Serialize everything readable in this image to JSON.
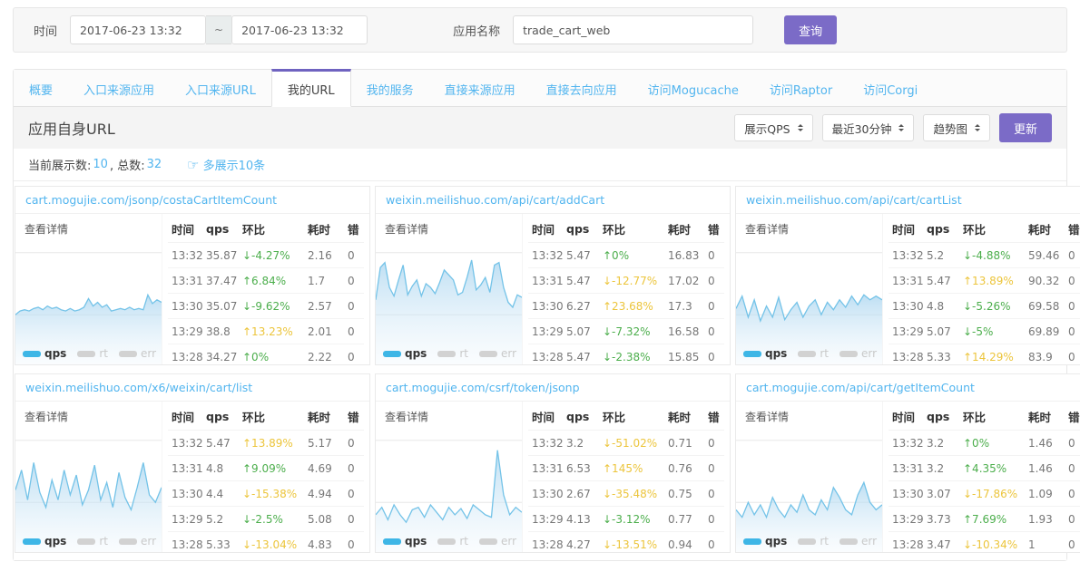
{
  "filter_bar": {
    "time_label": "时间",
    "time_from": "2017-06-23 13:32",
    "time_separator": "~",
    "time_to": "2017-06-23 13:32",
    "app_label": "应用名称",
    "app_value": "trade_cart_web",
    "query_button": "查询"
  },
  "tabs": {
    "items": [
      {
        "label": "概要",
        "active": false
      },
      {
        "label": "入口来源应用",
        "active": false
      },
      {
        "label": "入口来源URL",
        "active": false
      },
      {
        "label": "我的URL",
        "active": true
      },
      {
        "label": "我的服务",
        "active": false
      },
      {
        "label": "直接来源应用",
        "active": false
      },
      {
        "label": "直接去向应用",
        "active": false
      },
      {
        "label": "访问Mogucache",
        "active": false
      },
      {
        "label": "访问Raptor",
        "active": false
      },
      {
        "label": "访问Corgi",
        "active": false
      }
    ]
  },
  "section": {
    "title": "应用自身URL",
    "metric_select": "展示QPS",
    "range_select": "最近30分钟",
    "chart_type_select": "趋势图",
    "refresh_button": "更新"
  },
  "summary": {
    "shown_label": "当前展示数:",
    "shown_value": "10",
    "total_label": ", 总数:",
    "total_value": "32",
    "more_icon": "☞",
    "more_link": "多展示10条"
  },
  "panel_common": {
    "detail_label": "查看详情",
    "columns": [
      "时间",
      "qps",
      "环比",
      "耗时",
      "错"
    ],
    "legend": [
      {
        "label": "qps",
        "active": true
      },
      {
        "label": "rt",
        "active": false
      },
      {
        "label": "err",
        "active": false
      }
    ]
  },
  "colors": {
    "accent_purple": "#7b6bc7",
    "link_blue": "#52b5ef",
    "delta_green": "#4cae4c",
    "delta_yellow": "#ecc53c",
    "spark_line": "#74c3e8"
  },
  "panels": [
    {
      "url": "cart.mogujie.com/jsonp/costaCartItemCount",
      "rows": [
        {
          "time": "13:32",
          "qps": "35.87",
          "dir": "down",
          "delta": "-4.27%",
          "tone": "green",
          "cost": "2.16",
          "err": "0"
        },
        {
          "time": "13:31",
          "qps": "37.47",
          "dir": "up",
          "delta": "6.84%",
          "tone": "green",
          "cost": "1.7",
          "err": "0"
        },
        {
          "time": "13:30",
          "qps": "35.07",
          "dir": "down",
          "delta": "-9.62%",
          "tone": "green",
          "cost": "2.57",
          "err": "0"
        },
        {
          "time": "13:29",
          "qps": "38.8",
          "dir": "up",
          "delta": "13.23%",
          "tone": "yellow",
          "cost": "2.01",
          "err": "0"
        },
        {
          "time": "13:28",
          "qps": "34.27",
          "dir": "up",
          "delta": "0%",
          "tone": "green",
          "cost": "2.22",
          "err": "0"
        }
      ],
      "spark": [
        0.4,
        0.43,
        0.44,
        0.43,
        0.45,
        0.46,
        0.44,
        0.47,
        0.45,
        0.46,
        0.44,
        0.43,
        0.45,
        0.43,
        0.44,
        0.46,
        0.53,
        0.47,
        0.5,
        0.46,
        0.48,
        0.43,
        0.44,
        0.45,
        0.44,
        0.46,
        0.44,
        0.45,
        0.44,
        0.56,
        0.49,
        0.52,
        0.5
      ]
    },
    {
      "url": "weixin.meilishuo.com/api/cart/addCart",
      "rows": [
        {
          "time": "13:32",
          "qps": "5.47",
          "dir": "up",
          "delta": "0%",
          "tone": "green",
          "cost": "16.83",
          "err": "0"
        },
        {
          "time": "13:31",
          "qps": "5.47",
          "dir": "down",
          "delta": "-12.77%",
          "tone": "yellow",
          "cost": "17.02",
          "err": "0"
        },
        {
          "time": "13:30",
          "qps": "6.27",
          "dir": "up",
          "delta": "23.68%",
          "tone": "yellow",
          "cost": "17.3",
          "err": "0"
        },
        {
          "time": "13:29",
          "qps": "5.07",
          "dir": "down",
          "delta": "-7.32%",
          "tone": "green",
          "cost": "16.58",
          "err": "0"
        },
        {
          "time": "13:28",
          "qps": "5.47",
          "dir": "down",
          "delta": "-2.38%",
          "tone": "green",
          "cost": "15.85",
          "err": "0"
        }
      ],
      "spark": [
        0.52,
        0.78,
        0.82,
        0.62,
        0.55,
        0.68,
        0.8,
        0.56,
        0.63,
        0.68,
        0.55,
        0.65,
        0.62,
        0.57,
        0.66,
        0.76,
        0.72,
        0.68,
        0.56,
        0.58,
        0.7,
        0.84,
        0.6,
        0.64,
        0.7,
        0.58,
        0.8,
        0.82,
        0.62,
        0.5,
        0.46,
        0.56,
        0.54
      ]
    },
    {
      "url": "weixin.meilishuo.com/api/cart/cartList",
      "rows": [
        {
          "time": "13:32",
          "qps": "5.2",
          "dir": "down",
          "delta": "-4.88%",
          "tone": "green",
          "cost": "59.46",
          "err": "0"
        },
        {
          "time": "13:31",
          "qps": "5.47",
          "dir": "up",
          "delta": "13.89%",
          "tone": "yellow",
          "cost": "90.32",
          "err": "0"
        },
        {
          "time": "13:30",
          "qps": "4.8",
          "dir": "down",
          "delta": "-5.26%",
          "tone": "green",
          "cost": "69.58",
          "err": "0"
        },
        {
          "time": "13:29",
          "qps": "5.07",
          "dir": "down",
          "delta": "-5%",
          "tone": "green",
          "cost": "69.89",
          "err": "0"
        },
        {
          "time": "13:28",
          "qps": "5.33",
          "dir": "up",
          "delta": "14.29%",
          "tone": "yellow",
          "cost": "83.9",
          "err": "0"
        }
      ],
      "spark": [
        0.45,
        0.55,
        0.38,
        0.52,
        0.35,
        0.47,
        0.38,
        0.54,
        0.36,
        0.44,
        0.5,
        0.38,
        0.47,
        0.52,
        0.4,
        0.5,
        0.44,
        0.52,
        0.46,
        0.55,
        0.48,
        0.56,
        0.52,
        0.55,
        0.52
      ]
    },
    {
      "url": "weixin.meilishuo.com/x6/weixin/cart/list",
      "rows": [
        {
          "time": "13:32",
          "qps": "5.47",
          "dir": "up",
          "delta": "13.89%",
          "tone": "yellow",
          "cost": "5.17",
          "err": "0"
        },
        {
          "time": "13:31",
          "qps": "4.8",
          "dir": "up",
          "delta": "9.09%",
          "tone": "green",
          "cost": "4.69",
          "err": "0"
        },
        {
          "time": "13:30",
          "qps": "4.4",
          "dir": "down",
          "delta": "-15.38%",
          "tone": "yellow",
          "cost": "4.94",
          "err": "0"
        },
        {
          "time": "13:29",
          "qps": "5.2",
          "dir": "down",
          "delta": "-2.5%",
          "tone": "green",
          "cost": "5.08",
          "err": "0"
        },
        {
          "time": "13:28",
          "qps": "5.33",
          "dir": "down",
          "delta": "-13.04%",
          "tone": "yellow",
          "cost": "4.83",
          "err": "0"
        }
      ],
      "spark": [
        0.5,
        0.66,
        0.42,
        0.72,
        0.48,
        0.36,
        0.58,
        0.42,
        0.66,
        0.46,
        0.62,
        0.38,
        0.5,
        0.7,
        0.42,
        0.56,
        0.36,
        0.64,
        0.44,
        0.34,
        0.52,
        0.72,
        0.46,
        0.4,
        0.52
      ]
    },
    {
      "url": "cart.mogujie.com/csrf/token/jsonp",
      "rows": [
        {
          "time": "13:32",
          "qps": "3.2",
          "dir": "down",
          "delta": "-51.02%",
          "tone": "yellow",
          "cost": "0.71",
          "err": "0"
        },
        {
          "time": "13:31",
          "qps": "6.53",
          "dir": "up",
          "delta": "145%",
          "tone": "yellow",
          "cost": "0.76",
          "err": "0"
        },
        {
          "time": "13:30",
          "qps": "2.67",
          "dir": "down",
          "delta": "-35.48%",
          "tone": "yellow",
          "cost": "0.75",
          "err": "0"
        },
        {
          "time": "13:29",
          "qps": "4.13",
          "dir": "down",
          "delta": "-3.12%",
          "tone": "green",
          "cost": "0.77",
          "err": "0"
        },
        {
          "time": "13:28",
          "qps": "4.27",
          "dir": "down",
          "delta": "-13.51%",
          "tone": "yellow",
          "cost": "0.94",
          "err": "0"
        }
      ],
      "spark": [
        0.3,
        0.36,
        0.26,
        0.38,
        0.3,
        0.24,
        0.34,
        0.36,
        0.28,
        0.38,
        0.32,
        0.26,
        0.36,
        0.3,
        0.35,
        0.27,
        0.38,
        0.34,
        0.3,
        0.28,
        0.82,
        0.46,
        0.3,
        0.36,
        0.32
      ]
    },
    {
      "url": "cart.mogujie.com/api/cart/getItemCount",
      "rows": [
        {
          "time": "13:32",
          "qps": "3.2",
          "dir": "up",
          "delta": "0%",
          "tone": "green",
          "cost": "1.46",
          "err": "0"
        },
        {
          "time": "13:31",
          "qps": "3.2",
          "dir": "up",
          "delta": "4.35%",
          "tone": "green",
          "cost": "1.46",
          "err": "0"
        },
        {
          "time": "13:30",
          "qps": "3.07",
          "dir": "down",
          "delta": "-17.86%",
          "tone": "yellow",
          "cost": "1.09",
          "err": "0"
        },
        {
          "time": "13:29",
          "qps": "3.73",
          "dir": "up",
          "delta": "7.69%",
          "tone": "green",
          "cost": "1.93",
          "err": "0"
        },
        {
          "time": "13:28",
          "qps": "3.47",
          "dir": "down",
          "delta": "-10.34%",
          "tone": "yellow",
          "cost": "1",
          "err": "0"
        }
      ],
      "spark": [
        0.34,
        0.28,
        0.4,
        0.3,
        0.38,
        0.28,
        0.44,
        0.34,
        0.28,
        0.38,
        0.32,
        0.46,
        0.34,
        0.3,
        0.42,
        0.34,
        0.52,
        0.44,
        0.34,
        0.3,
        0.46,
        0.56,
        0.4,
        0.34,
        0.38
      ]
    }
  ]
}
